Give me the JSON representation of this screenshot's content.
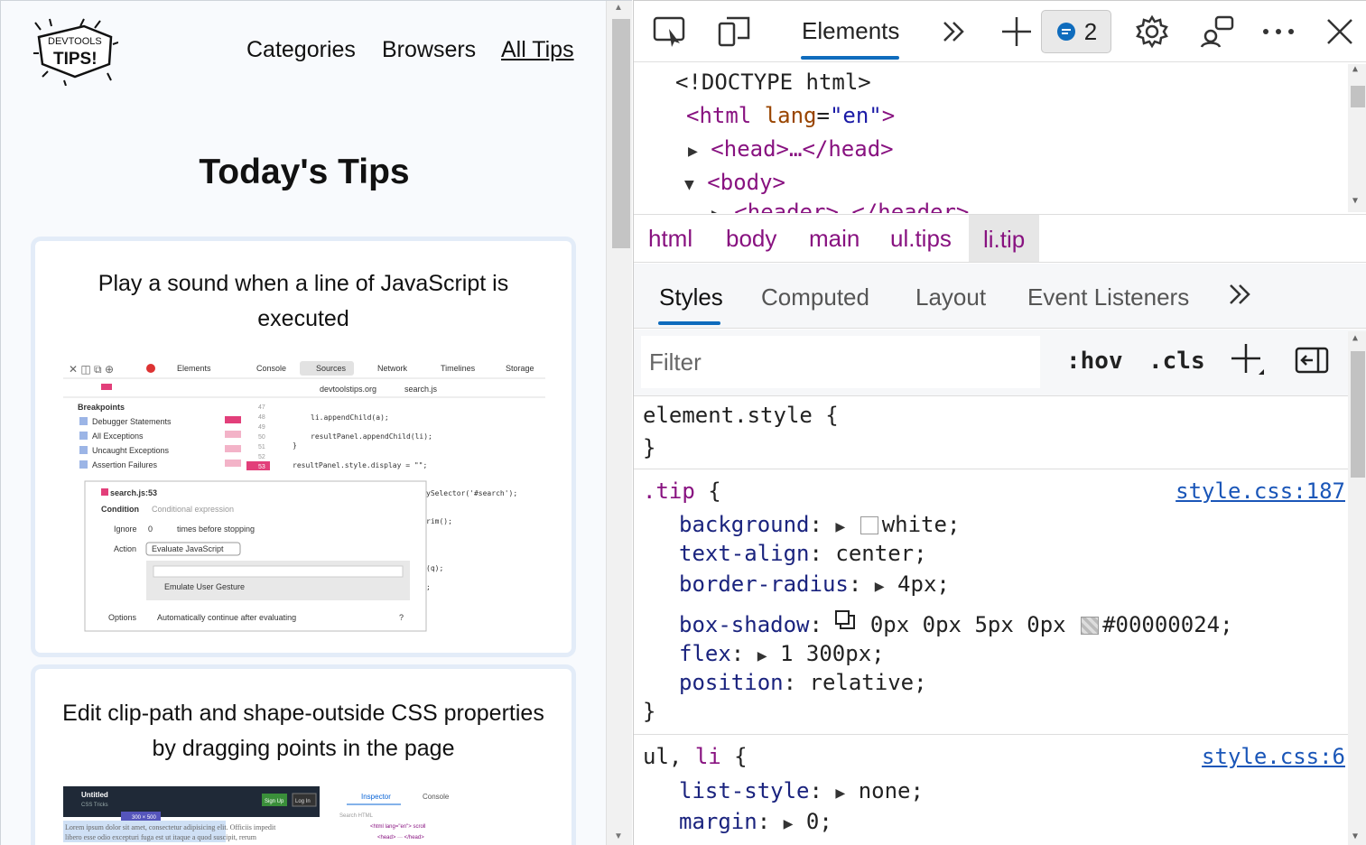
{
  "page": {
    "logo_line1": "DEVTOOLS",
    "logo_line2": "TIPS!",
    "nav": [
      "Categories",
      "Browsers",
      "All Tips"
    ],
    "title": "Today's Tips",
    "cards": [
      {
        "title": "Play a sound when a line of JavaScript is executed",
        "shot": {
          "tabs": [
            "Elements",
            "Console",
            "Sources",
            "Network",
            "Timelines",
            "Storage"
          ],
          "file_crumb": [
            "devtoolstips.org",
            "search.js"
          ],
          "breakpoints_title": "Breakpoints",
          "breakpoints": [
            "Debugger Statements",
            "All Exceptions",
            "Uncaught Exceptions",
            "Assertion Failures"
          ],
          "line_numbers": [
            "47",
            "48",
            "49",
            "50",
            "51",
            "52",
            "53"
          ],
          "code": [
            "li.appendChild(a);",
            "resultPanel.appendChild(li);",
            "}",
            "resultPanel.style.display = \"\";",
            "ySelector('#search');",
            "rim();",
            "(q);",
            ";"
          ],
          "popup_title": "search.js:53",
          "condition_label": "Condition",
          "condition_placeholder": "Conditional expression",
          "ignore_label": "Ignore",
          "ignore_value": "0",
          "ignore_suffix": "times before stopping",
          "action_label": "Action",
          "action_value": "Evaluate JavaScript",
          "emulate_label": "Emulate User Gesture",
          "options_label": "Options",
          "options_value": "Automatically continue after evaluating",
          "help": "?"
        }
      },
      {
        "title": "Edit clip-path and shape-outside CSS properties by dragging points in the page",
        "shot": {
          "app_title": "Untitled",
          "app_sub": "CSS Tricks",
          "signup": "Sign Up",
          "login": "Log In",
          "size_tag": "300 × 500",
          "lorem1": "Lorem ipsum dolor sit amet, consectetur adipisicing elit. Officiis impedit",
          "lorem2": "libero esse odio excepturi fuga est ut itaque a quod suscipit, rerum",
          "tabs": [
            "Inspector",
            "Console"
          ],
          "search_placeholder": "Search HTML",
          "html_line": "<html lang=\"en\"> scroll",
          "head_line": "<head> ··· </head>"
        }
      }
    ]
  },
  "devtools": {
    "main_tab": "Elements",
    "issues_count": "2",
    "dom": {
      "doctype": "<!DOCTYPE html>",
      "html_open": "<html",
      "lang_attr": "lang",
      "lang_val": "\"en\"",
      "head": "<head>…</head>",
      "body": "<body>",
      "header": "<header>…</header>"
    },
    "breadcrumbs": [
      "html",
      "body",
      "main",
      "ul.tips",
      "li.tip"
    ],
    "subtabs": [
      "Styles",
      "Computed",
      "Layout",
      "Event Listeners"
    ],
    "filter_placeholder": "Filter",
    "hov": ":hov",
    "cls": ".cls",
    "element_style": "element.style {",
    "close_brace": "}",
    "tip_rule": {
      "selector": ".tip",
      "open": " {",
      "source": "style.css:187",
      "props": [
        {
          "name": "background",
          "value": "white;"
        },
        {
          "name": "text-align",
          "value": "center;"
        },
        {
          "name": "border-radius",
          "value": "4px;"
        },
        {
          "name": "box-shadow",
          "value": "0px 0px 5px 0px",
          "color": "#00000024;"
        },
        {
          "name": "flex",
          "value": "1 300px;"
        },
        {
          "name": "position",
          "value": "relative;"
        }
      ]
    },
    "ul_rule": {
      "selector_a": "ul",
      "comma": ", ",
      "selector_b": "li",
      "open": " {",
      "source": "style.css:6",
      "props": [
        {
          "name": "list-style",
          "value": "none;"
        },
        {
          "name": "margin",
          "value": "0;"
        }
      ]
    },
    "colors": {
      "accent": "#0f6cbd",
      "tag": "#881280",
      "attr": "#994500",
      "link": "#1a56b8"
    }
  }
}
